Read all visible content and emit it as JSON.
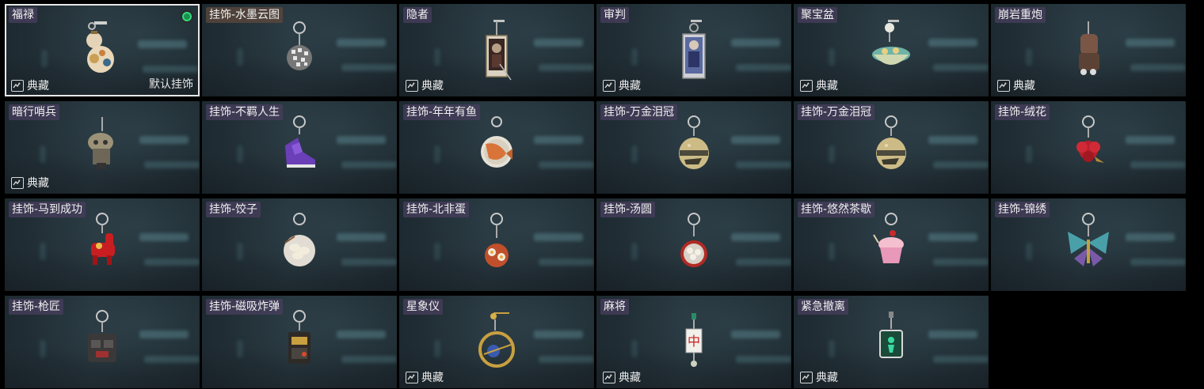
{
  "screen": {
    "collection_label": "典藏",
    "default_label": "默认挂饰"
  },
  "items": [
    {
      "name": "福禄",
      "collection": true,
      "selected": true,
      "equipped": true,
      "is_default": true,
      "charm": "gourd-charm"
    },
    {
      "name": "挂饰-水墨云图",
      "collection": false,
      "charm": "disco-ball-charm"
    },
    {
      "name": "隐者",
      "collection": true,
      "charm": "tarot-card-charm"
    },
    {
      "name": "审判",
      "collection": true,
      "charm": "judgement-card-charm"
    },
    {
      "name": "聚宝盆",
      "collection": true,
      "charm": "treasure-bowl-charm"
    },
    {
      "name": "崩岩重炮",
      "collection": true,
      "charm": "rock-cannon-charm"
    },
    {
      "name": "暗行哨兵",
      "collection": true,
      "charm": "sentinel-charm"
    },
    {
      "name": "挂饰-不羁人生",
      "collection": false,
      "charm": "sneaker-charm"
    },
    {
      "name": "挂饰-年年有鱼",
      "collection": false,
      "charm": "fish-plate-charm"
    },
    {
      "name": "挂饰-万金泪冠",
      "collection": false,
      "charm": "gold-crown-charm"
    },
    {
      "name": "挂饰-万金泪冠",
      "collection": false,
      "charm": "gold-crown-charm"
    },
    {
      "name": "挂饰-绒花",
      "collection": false,
      "charm": "velvet-flower-charm"
    },
    {
      "name": "挂饰-马到成功",
      "collection": false,
      "charm": "red-horse-charm"
    },
    {
      "name": "挂饰-饺子",
      "collection": false,
      "charm": "dumpling-plate-charm"
    },
    {
      "name": "挂饰-北非蛋",
      "collection": false,
      "charm": "shakshuka-charm"
    },
    {
      "name": "挂饰-汤圆",
      "collection": false,
      "charm": "tangyuan-bowl-charm"
    },
    {
      "name": "挂饰-悠然茶歇",
      "collection": false,
      "charm": "cupcake-charm"
    },
    {
      "name": "挂饰-锦绣",
      "collection": false,
      "charm": "butterfly-charm"
    },
    {
      "name": "挂饰-枪匠",
      "collection": false,
      "charm": "gunsmith-vest-charm"
    },
    {
      "name": "挂饰-磁吸炸弹",
      "collection": false,
      "charm": "magnetic-bomb-charm"
    },
    {
      "name": "星象仪",
      "collection": true,
      "charm": "astrolabe-charm"
    },
    {
      "name": "麻将",
      "collection": true,
      "charm": "mahjong-tile-charm"
    },
    {
      "name": "紧急撤离",
      "collection": true,
      "charm": "emergency-sign-charm"
    }
  ],
  "colors": {
    "card_bg": "#24323a",
    "selected_border": "#e8e8e8",
    "equipped_dot": "#2fe07a",
    "title_bg": "#463e5c"
  }
}
